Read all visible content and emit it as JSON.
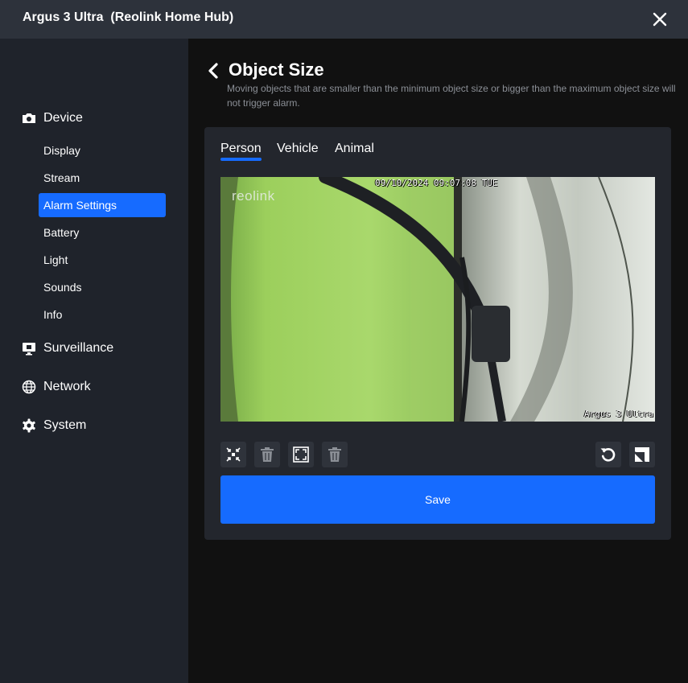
{
  "window": {
    "title": "Argus 3 Ultra  (Reolink Home Hub)",
    "close_icon": "close-icon"
  },
  "sidebar": {
    "sections": [
      {
        "label": "Device",
        "icon": "camera-icon"
      },
      {
        "label": "Surveillance",
        "icon": "monitor-icon"
      },
      {
        "label": "Network",
        "icon": "globe-icon"
      },
      {
        "label": "System",
        "icon": "gear-icon"
      }
    ],
    "device_items": [
      {
        "label": "Display"
      },
      {
        "label": "Stream"
      },
      {
        "label": "Alarm Settings",
        "active": true
      },
      {
        "label": "Battery"
      },
      {
        "label": "Light"
      },
      {
        "label": "Sounds"
      },
      {
        "label": "Info"
      }
    ]
  },
  "main": {
    "back_icon": "chevron-left-icon",
    "title": "Object Size",
    "description": "Moving objects that are smaller than the minimum object size or bigger than the maximum object size will not trigger alarm.",
    "tabs": [
      {
        "label": "Person",
        "active": true
      },
      {
        "label": "Vehicle"
      },
      {
        "label": "Animal"
      }
    ],
    "preview": {
      "timestamp": "09/10/2024 09:07:08 TUE",
      "logo": "reolink",
      "camera_name": "Argus 3 Ultra"
    },
    "toolbar": {
      "left": [
        "min-size-icon",
        "trash-icon",
        "max-size-icon",
        "trash-icon"
      ],
      "right": [
        "reset-icon",
        "resize-icon"
      ]
    },
    "save_label": "Save"
  },
  "colors": {
    "accent": "#166bff",
    "sidebar_bg": "#1f232b",
    "titlebar_bg": "#2d323b",
    "card_bg": "#23262d",
    "page_bg": "#111111"
  }
}
